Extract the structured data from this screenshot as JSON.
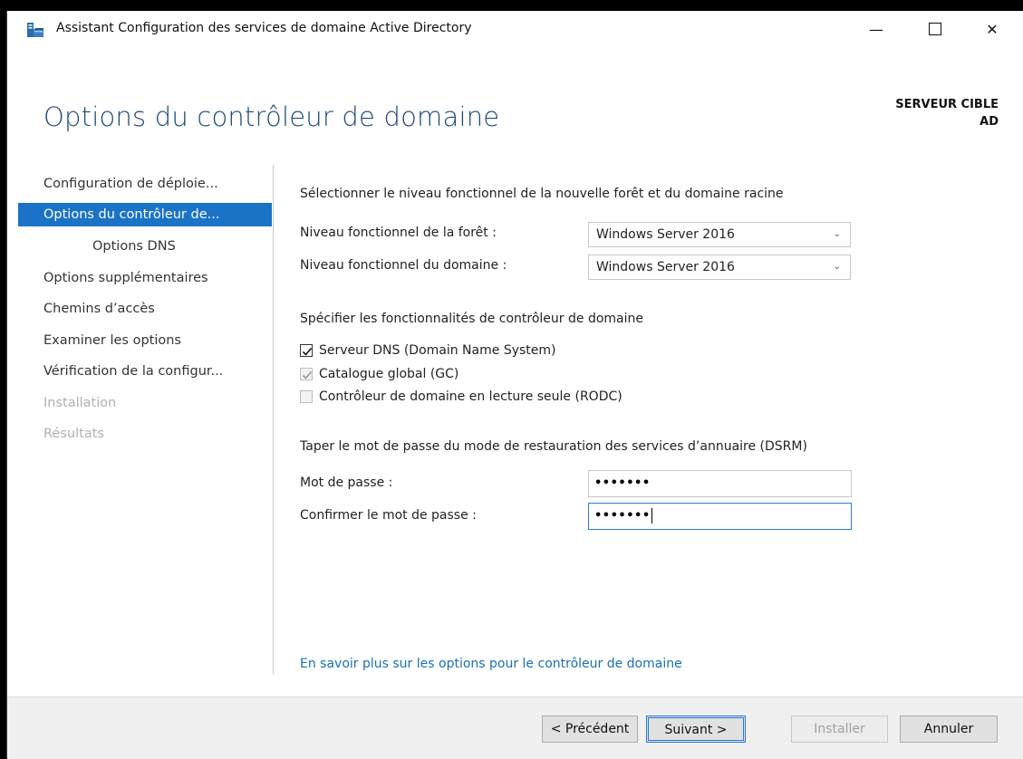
{
  "window": {
    "title": "Assistant Configuration des services de domaine Active Directory",
    "controls": {
      "minimize": "—",
      "close": "✕"
    }
  },
  "header": {
    "title": "Options du contrôleur de domaine",
    "target_label": "SERVEUR CIBLE",
    "target_name": "AD"
  },
  "nav": {
    "items": [
      {
        "label": "Configuration de déploie...",
        "state": "normal"
      },
      {
        "label": "Options du contrôleur de...",
        "state": "active"
      },
      {
        "label": "Options DNS",
        "state": "sub"
      },
      {
        "label": "Options supplémentaires",
        "state": "normal"
      },
      {
        "label": "Chemins d’accès",
        "state": "normal"
      },
      {
        "label": "Examiner les options",
        "state": "normal"
      },
      {
        "label": "Vérification de la configur...",
        "state": "normal"
      },
      {
        "label": "Installation",
        "state": "disabled"
      },
      {
        "label": "Résultats",
        "state": "disabled"
      }
    ]
  },
  "functional": {
    "heading": "Sélectionner le niveau fonctionnel de la nouvelle forêt et du domaine racine",
    "forest_label": "Niveau fonctionnel de la forêt :",
    "forest_value": "Windows Server 2016",
    "domain_label": "Niveau fonctionnel du domaine :",
    "domain_value": "Windows Server 2016"
  },
  "capabilities": {
    "heading": "Spécifier les fonctionnalités de contrôleur de domaine",
    "dns": {
      "label": "Serveur DNS (Domain Name System)",
      "checked": true
    },
    "gc": {
      "label": "Catalogue global (GC)",
      "checked": true,
      "disabled": true
    },
    "rodc": {
      "label": "Contrôleur de domaine en lecture seule (RODC)",
      "checked": false,
      "disabled": true
    }
  },
  "dsrm": {
    "heading": "Taper le mot de passe du mode de restauration des services d’annuaire (DSRM)",
    "password_label": "Mot de passe :",
    "password_value": "•••••••",
    "confirm_label": "Confirmer le mot de passe :",
    "confirm_value": "•••••••"
  },
  "link": {
    "text": "En savoir plus sur les options pour le contrôleur de domaine"
  },
  "buttons": {
    "previous": "< Précédent",
    "next": "Suivant >",
    "install": "Installer",
    "cancel": "Annuler"
  },
  "colors": {
    "accent": "#1a73c6",
    "title": "#1a4a7a",
    "link": "#1a6fb8"
  }
}
